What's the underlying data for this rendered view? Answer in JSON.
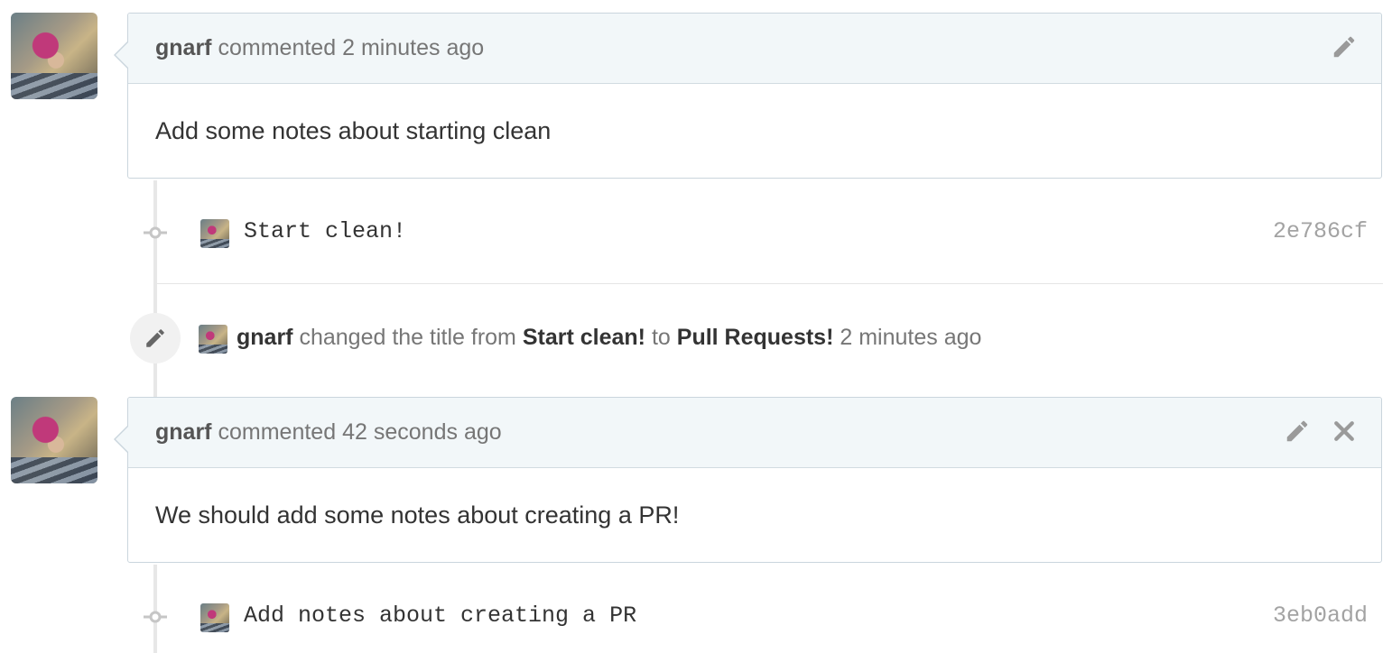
{
  "comments": [
    {
      "author": "gnarf",
      "action": "commented",
      "time": "2 minutes ago",
      "body": "Add some notes about starting clean",
      "actions": [
        "edit-icon"
      ]
    },
    {
      "author": "gnarf",
      "action": "commented",
      "time": "42 seconds ago",
      "body": "We should add some notes about creating a PR!",
      "actions": [
        "edit-icon",
        "close-icon"
      ]
    }
  ],
  "commits": [
    {
      "message": "Start clean!",
      "sha": "2e786cf"
    },
    {
      "message": "Add notes about creating a PR",
      "sha": "3eb0add"
    }
  ],
  "title_change_event": {
    "author": "gnarf",
    "text_before": "changed the title from",
    "old_title": "Start clean!",
    "text_between": "to",
    "new_title": "Pull Requests!",
    "time": "2 minutes ago"
  },
  "colors": {
    "header_bg": "#f2f7f9",
    "border": "#cad5dd",
    "muted_text": "#767676",
    "sha_text": "#a3a3a3"
  }
}
